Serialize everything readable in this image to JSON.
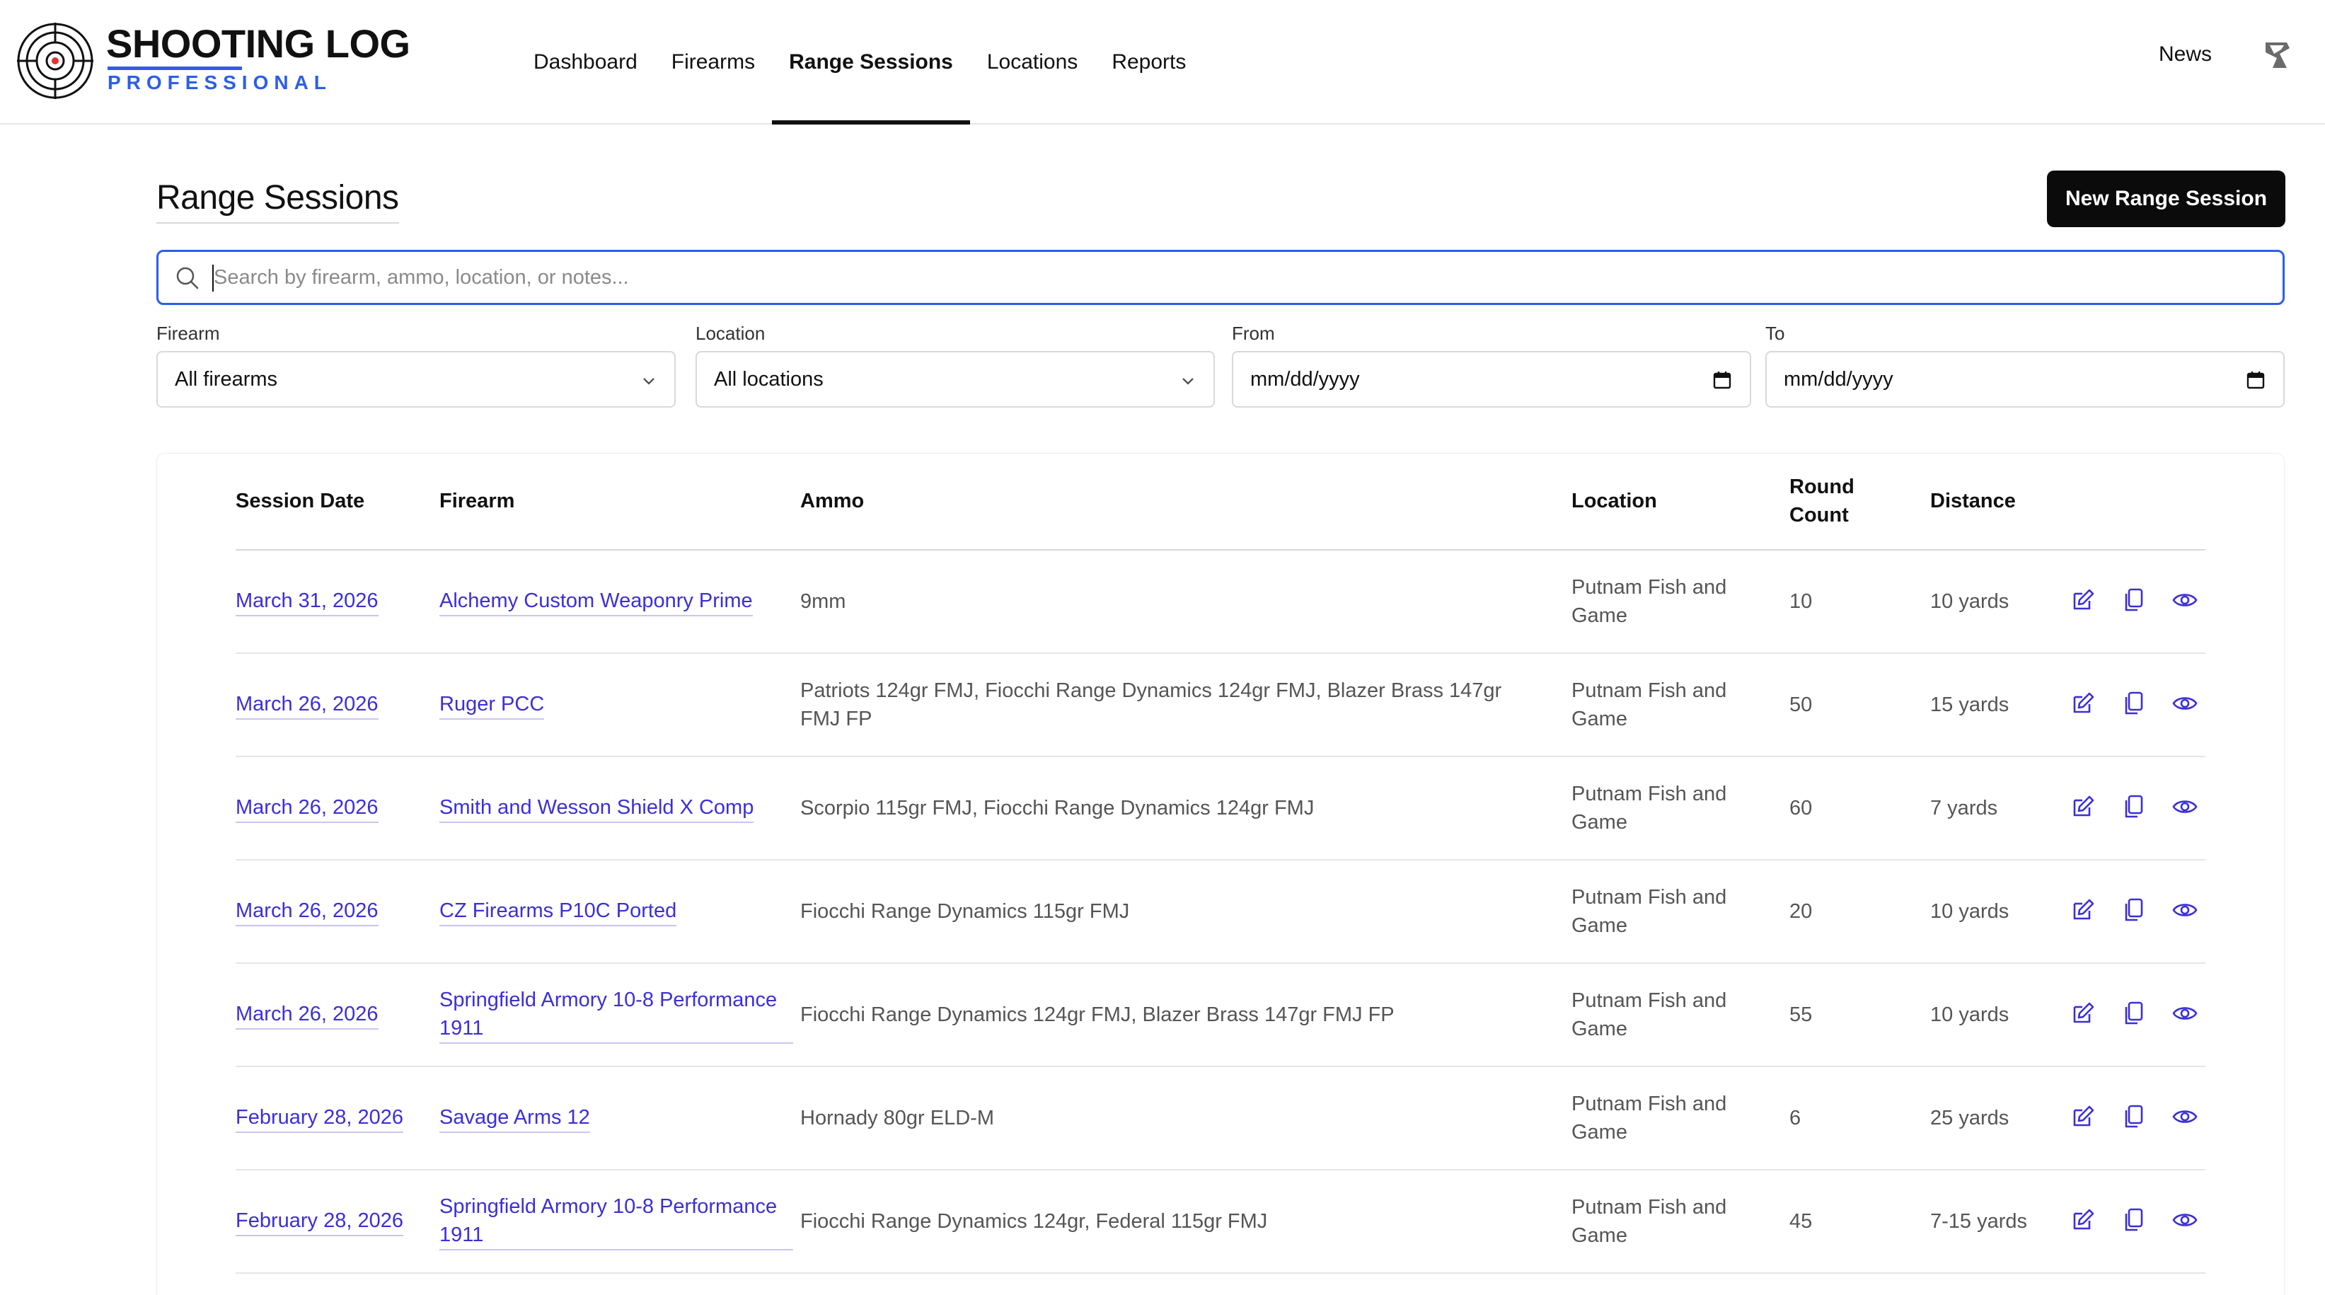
{
  "app": {
    "title": "SHOOTING LOG",
    "subtitle": "PROFESSIONAL"
  },
  "nav": {
    "items": [
      {
        "label": "Dashboard",
        "active": false
      },
      {
        "label": "Firearms",
        "active": false
      },
      {
        "label": "Range Sessions",
        "active": true
      },
      {
        "label": "Locations",
        "active": false
      },
      {
        "label": "Reports",
        "active": false
      }
    ],
    "news_label": "News",
    "user_icon": "user-avatar-icon"
  },
  "page": {
    "title": "Range Sessions",
    "new_button": "New Range Session"
  },
  "search": {
    "placeholder": "Search by firearm, ammo, location, or notes...",
    "value": ""
  },
  "filters": {
    "firearm": {
      "label": "Firearm",
      "value": "All firearms"
    },
    "location": {
      "label": "Location",
      "value": "All locations"
    },
    "from": {
      "label": "From",
      "value": "mm/dd/yyyy"
    },
    "to": {
      "label": "To",
      "value": "mm/dd/yyyy"
    }
  },
  "table": {
    "columns": [
      "Session Date",
      "Firearm",
      "Ammo",
      "Location",
      "Round Count",
      "Distance"
    ],
    "rows": [
      {
        "date": "March 31, 2026",
        "firearm": "Alchemy Custom Weaponry Prime",
        "ammo": "9mm",
        "location": "Putnam Fish and Game",
        "rounds": "10",
        "distance": "10 yards"
      },
      {
        "date": "March 26, 2026",
        "firearm": "Ruger PCC",
        "ammo": "Patriots 124gr FMJ, Fiocchi Range Dynamics 124gr FMJ, Blazer Brass 147gr FMJ FP",
        "location": "Putnam Fish and Game",
        "rounds": "50",
        "distance": "15 yards"
      },
      {
        "date": "March 26, 2026",
        "firearm": "Smith and Wesson Shield X Comp",
        "ammo": "Scorpio 115gr FMJ, Fiocchi Range Dynamics 124gr FMJ",
        "location": "Putnam Fish and Game",
        "rounds": "60",
        "distance": "7 yards"
      },
      {
        "date": "March 26, 2026",
        "firearm": "CZ Firearms P10C Ported",
        "ammo": "Fiocchi Range Dynamics 115gr FMJ",
        "location": "Putnam Fish and Game",
        "rounds": "20",
        "distance": "10 yards"
      },
      {
        "date": "March 26, 2026",
        "firearm": "Springfield Armory 10-8 Performance 1911",
        "ammo": "Fiocchi Range Dynamics 124gr FMJ, Blazer Brass 147gr FMJ FP",
        "location": "Putnam Fish and Game",
        "rounds": "55",
        "distance": "10 yards"
      },
      {
        "date": "February 28, 2026",
        "firearm": "Savage Arms 12",
        "ammo": "Hornady 80gr ELD-M",
        "location": "Putnam Fish and Game",
        "rounds": "6",
        "distance": "25 yards"
      },
      {
        "date": "February 28, 2026",
        "firearm": "Springfield Armory 10-8 Performance 1911",
        "ammo": "Fiocchi Range Dynamics 124gr, Federal 115gr FMJ",
        "location": "Putnam Fish and Game",
        "rounds": "45",
        "distance": "7-15 yards"
      }
    ],
    "row_actions": [
      "edit-icon",
      "duplicate-icon",
      "view-icon"
    ]
  },
  "colors": {
    "accent": "#2c5fe8",
    "link": "#3b2fd6",
    "button": "#0b0b0b"
  }
}
